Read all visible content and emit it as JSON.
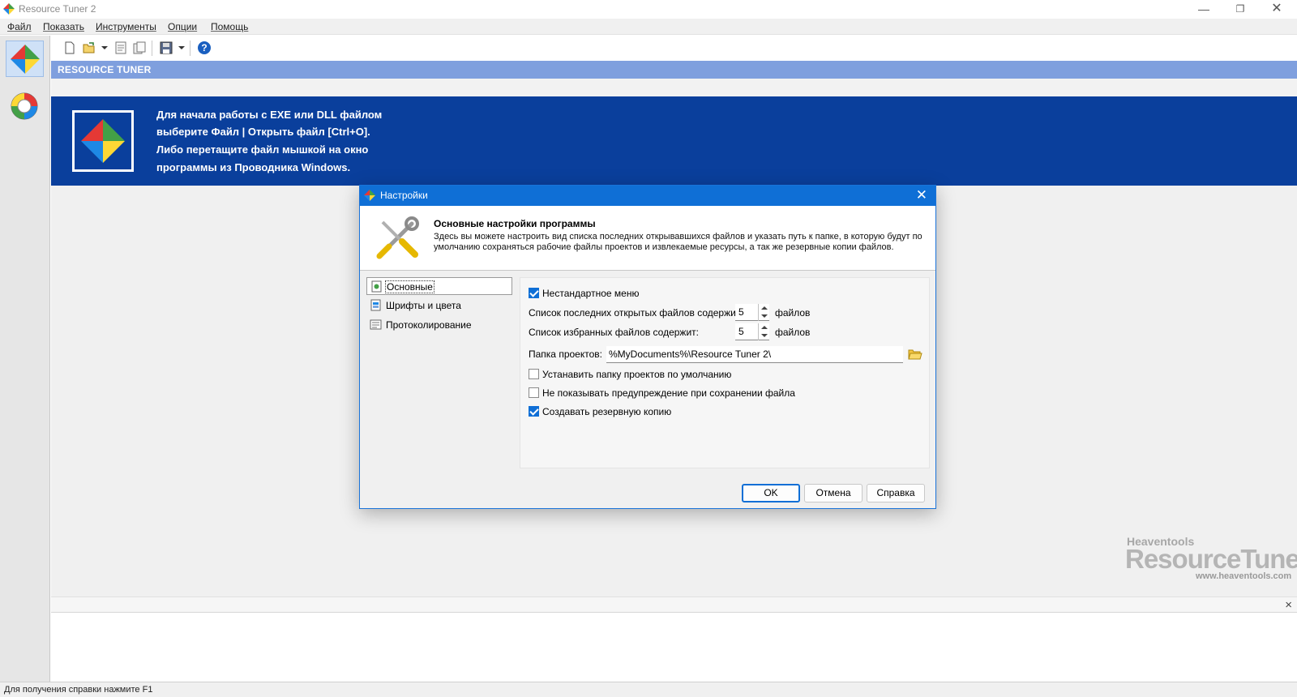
{
  "window": {
    "title": "Resource Tuner 2",
    "controls": {
      "minimize": "—",
      "restore": "❐",
      "close": "✕"
    }
  },
  "menu": {
    "items": [
      "Файл",
      "Показать",
      "Инструменты",
      "Опции",
      "Помощь"
    ]
  },
  "toolbar": {
    "icons": [
      "new-file-icon",
      "open-file-icon",
      "dropdown-arrow-icon",
      "properties-icon",
      "copy-icon",
      "save-icon",
      "dropdown-arrow-icon",
      "help-icon"
    ]
  },
  "header": {
    "label": "RESOURCE TUNER"
  },
  "banner": {
    "lines": [
      "Для начала работы с EXE или DLL файлом",
      "выберите Файл | Открыть файл [Ctrl+O].",
      "Либо перетащите файл мышкой на окно",
      "программы из Проводника Windows."
    ]
  },
  "branding": {
    "company": "Heaventools",
    "product": "ResourceTuner",
    "url": "www.heaventools.com"
  },
  "output_panel": {
    "close": "×"
  },
  "statusbar": {
    "text": "Для получения справки нажмите F1"
  },
  "dialog": {
    "title": "Настройки",
    "close": "✕",
    "heading": "Основные настройки программы",
    "description": "Здесь вы можете настроить вид списка последних открывавшихся файлов и указать путь к папке, в которую будут по умолчанию сохраняться рабочие файлы проектов и извлекаемые ресурсы, а так же резервные копии файлов.",
    "tree": [
      {
        "label": "Основные",
        "selected": true
      },
      {
        "label": "Шрифты и цвета",
        "selected": false
      },
      {
        "label": "Протоколирование",
        "selected": false
      }
    ],
    "options": {
      "custom_menu": {
        "label": "Нестандартное меню",
        "checked": true
      },
      "recent_files": {
        "label": "Список последних открытых файлов содержит:",
        "value": "5",
        "unit": "файлов"
      },
      "favorite_files": {
        "label": "Список избранных файлов содержит:",
        "value": "5",
        "unit": "файлов"
      },
      "project_folder": {
        "label": "Папка проектов:",
        "value": "%MyDocuments%\\Resource Tuner 2\\"
      },
      "set_default_folder": {
        "label": "Устанавить папку проектов по умолчанию",
        "checked": false
      },
      "no_save_warning": {
        "label": "Не показывать предупреждение при сохранении файла",
        "checked": false
      },
      "create_backup": {
        "label": "Создавать резервную копию",
        "checked": true
      }
    },
    "buttons": {
      "ok": "OK",
      "cancel": "Отмена",
      "help": "Справка"
    }
  },
  "colors": {
    "accent": "#0f6fd6",
    "banner": "#0a3f9c",
    "header_strip": "#7f9fde"
  }
}
